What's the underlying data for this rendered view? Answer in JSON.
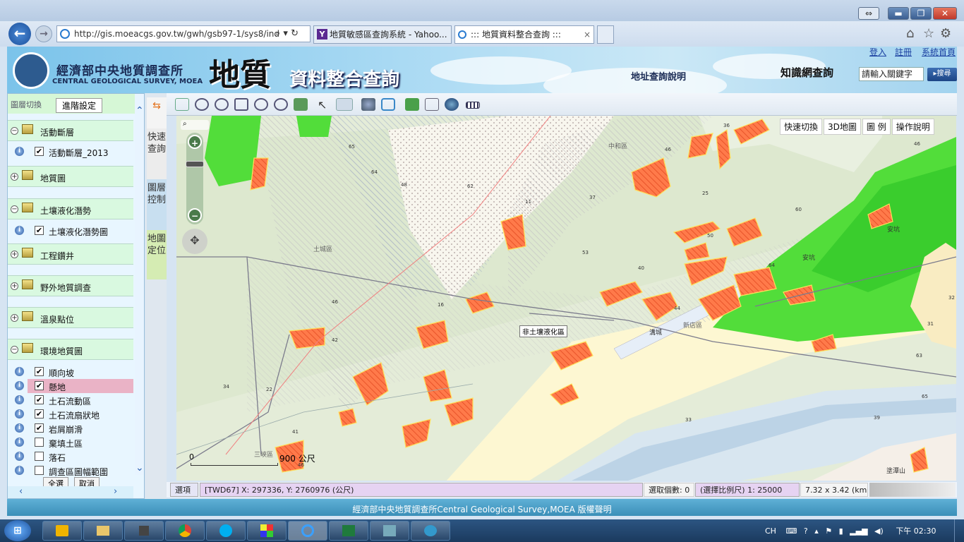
{
  "browser": {
    "url": "http://gis.moeacgs.gov.tw/gwh/gsb97-1/sys8/ind",
    "tabs": [
      {
        "label": "地質敏感區查詢系統 - Yahoo...",
        "active": false
      },
      {
        "label": "::: 地質資料整合查詢 :::",
        "active": true
      }
    ],
    "tab_close": "×"
  },
  "banner": {
    "org_cn": "經濟部中央地質調查所",
    "org_en": "CENTRAL GEOLOGICAL SURVEY, MOEA",
    "big_title": "地質",
    "sub_title": "資料整合查詢",
    "address_help": "地址查詢說明",
    "knowledge_label": "知識網查詢",
    "keyword_placeholder": "請輸入關鍵字",
    "search_btn": "搜尋",
    "links": [
      "登入",
      "註冊",
      "系統首頁"
    ]
  },
  "sidebar": {
    "top_label": "圖層切換",
    "advanced_btn": "進階設定",
    "groups": [
      {
        "label": "活動斷層",
        "expanded": true
      },
      {
        "label": "地質圖",
        "expanded": false
      },
      {
        "label": "土壤液化潛勢",
        "expanded": true
      },
      {
        "label": "工程鑽井",
        "expanded": false
      },
      {
        "label": "野外地質調查",
        "expanded": false
      },
      {
        "label": "溫泉點位",
        "expanded": false
      },
      {
        "label": "環境地質圖",
        "expanded": true
      }
    ],
    "items_fault": [
      {
        "label": "活動斷層_2013",
        "checked": "✔"
      }
    ],
    "items_liq": [
      {
        "label": "土壤液化潛勢圖",
        "checked": "✔"
      }
    ],
    "items_env": [
      {
        "label": "順向坡",
        "checked": "✔"
      },
      {
        "label": "懸地",
        "checked": "✔"
      },
      {
        "label": "土石流動區",
        "checked": "✔"
      },
      {
        "label": "土石流扇狀地",
        "checked": "✔"
      },
      {
        "label": "岩屑崩滑",
        "checked": "✔"
      },
      {
        "label": "棄填土區",
        "checked": ""
      },
      {
        "label": "落石",
        "checked": ""
      },
      {
        "label": "調查區圖幅範圍",
        "checked": ""
      }
    ],
    "select_all": "全選",
    "cancel": "取消"
  },
  "side_tabs": [
    "快速查詢",
    "圖層控制",
    "地圖定位"
  ],
  "map": {
    "top_buttons": [
      "快速切換",
      "3D地圖",
      "圖 例",
      "操作說明"
    ],
    "labels": [
      "中和區",
      "土城區",
      "安坑",
      "安坑",
      "新店區",
      "三峽區",
      "塗潭山",
      "溝城",
      "非土壤液化區"
    ],
    "scale_zero": "0",
    "scale_text": "900 公尺",
    "numbers": [
      "65",
      "64",
      "48",
      "62",
      "11",
      "37",
      "36",
      "46",
      "25",
      "46",
      "60",
      "50",
      "53",
      "40",
      "64",
      "16",
      "46",
      "44",
      "42",
      "34",
      "22",
      "41",
      "33",
      "32",
      "31",
      "63",
      "65",
      "39",
      "46"
    ]
  },
  "status": {
    "select": "選項",
    "coords": "[TWD67] X: 297336, Y: 2760976 (公尺)",
    "count": "選取個數: 0",
    "scale": "(選擇比例尺) 1: 25000",
    "extent": "7.32 x 3.42 (km)"
  },
  "footer": "經濟部中央地質調查所Central Geological Survey,MOEA 版權聲明",
  "tray": {
    "lang": "CH",
    "time": "下午 02:30"
  }
}
